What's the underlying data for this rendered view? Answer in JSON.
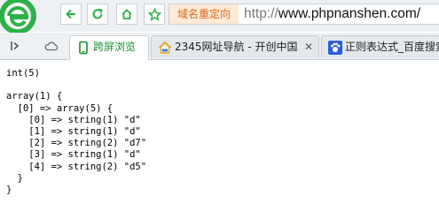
{
  "browser": {
    "redirect_label": "域名重定向",
    "url_prefix": "http://",
    "url_host": "www.phpnanshen.com/",
    "icons": {
      "logo": "browser-logo-icon",
      "back": "back-arrow-icon",
      "reload": "reload-icon",
      "home": "home-icon",
      "favorite": "star-icon",
      "sidebar": "sidebar-toggle-icon",
      "cloud": "cloud-icon"
    },
    "colors": {
      "logo_green": "#2fb14a",
      "active_tab_text": "#1a8f2e",
      "redirect_bg": "#fde9d6",
      "redirect_text": "#e06a1b"
    }
  },
  "tabs": [
    {
      "label": "跨屏浏览",
      "active": true,
      "icon": "phone-icon"
    },
    {
      "label": "2345网址导航 - 开创中国",
      "active": false,
      "icon": "house-2345-icon",
      "close": "✕"
    },
    {
      "label": "正则表达式_百度搜索",
      "active": false,
      "icon": "paw-icon",
      "close": "✕"
    }
  ],
  "page": {
    "output_lines": [
      "int(5)",
      "",
      "array(1) {",
      "  [0] => array(5) {",
      "    [0] => string(1) \"d\"",
      "    [1] => string(1) \"d\"",
      "    [2] => string(2) \"d7\"",
      "    [3] => string(1) \"d\"",
      "    [4] => string(2) \"d5\"",
      "  }",
      "}"
    ]
  }
}
